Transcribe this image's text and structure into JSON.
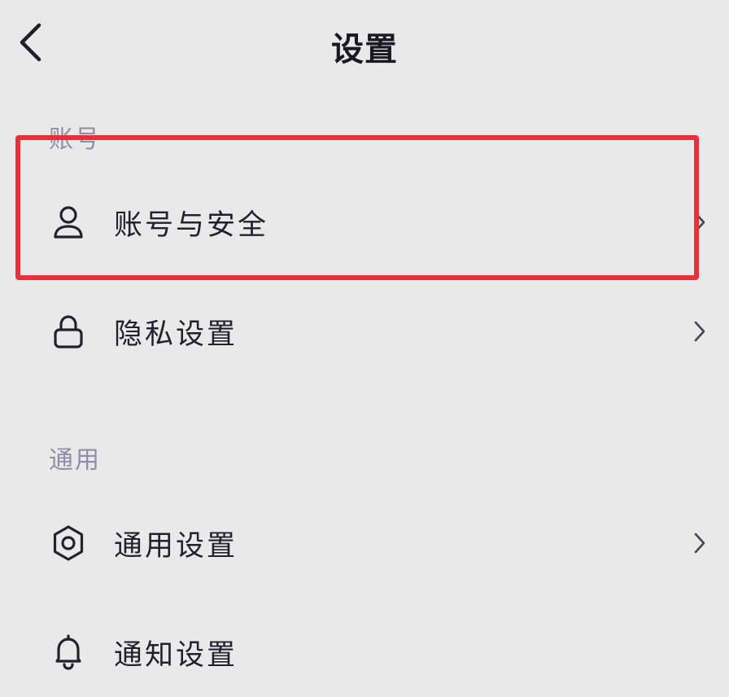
{
  "header": {
    "title": "设置"
  },
  "sections": [
    {
      "label": "账号",
      "items": [
        {
          "label": "账号与安全",
          "icon": "user-icon"
        },
        {
          "label": "隐私设置",
          "icon": "lock-icon"
        }
      ]
    },
    {
      "label": "通用",
      "items": [
        {
          "label": "通用设置",
          "icon": "gear-icon"
        },
        {
          "label": "通知设置",
          "icon": "bell-icon"
        }
      ]
    }
  ],
  "colors": {
    "background": "#e9e9ea",
    "text": "#22222e",
    "section_label": "#8f8ea6",
    "highlight": "#e8303b"
  }
}
